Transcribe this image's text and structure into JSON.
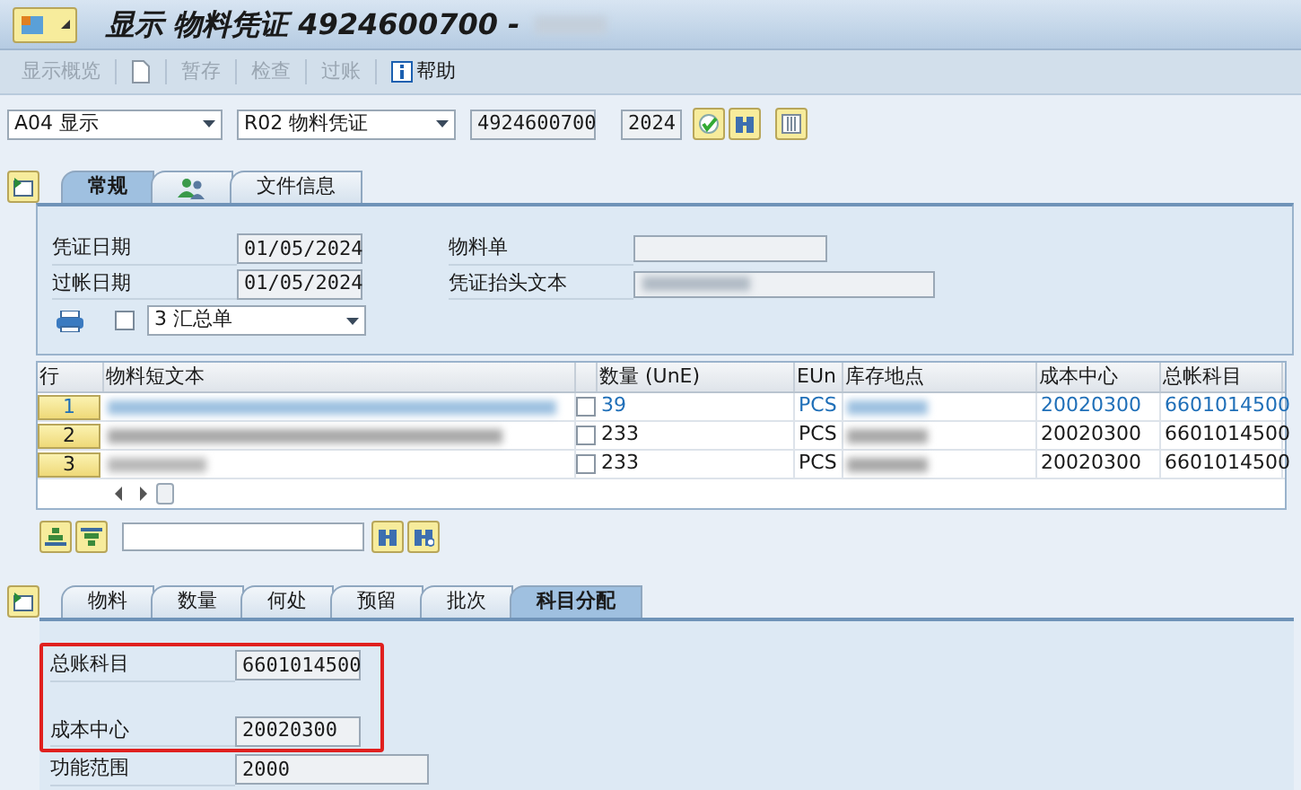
{
  "window": {
    "title": "显示 物料凭证 4924600700 -"
  },
  "toolbar": [
    {
      "kind": "button",
      "label": "显示概览",
      "disabled": true
    },
    {
      "kind": "page-icon"
    },
    {
      "kind": "button",
      "label": "暂存",
      "disabled": true
    },
    {
      "kind": "button",
      "label": "检查",
      "disabled": true
    },
    {
      "kind": "button",
      "label": "过账",
      "disabled": true
    },
    {
      "kind": "help",
      "label": "帮助",
      "disabled": false
    }
  ],
  "selectors": {
    "action": "A04 显示",
    "reference": "R02 物料凭证",
    "document_number": "4924600700",
    "year": "2024"
  },
  "header_tabs": [
    {
      "kind": "text",
      "label": "常规",
      "selected": true
    },
    {
      "kind": "people-icon",
      "selected": false
    },
    {
      "kind": "text",
      "label": "文件信息",
      "selected": false
    }
  ],
  "general": {
    "left_fields": [
      {
        "label": "凭证日期",
        "value": "01/05/2024"
      },
      {
        "label": "过帐日期",
        "value": "01/05/2024"
      }
    ],
    "right_fields": [
      {
        "label": "物料单",
        "redacted": false
      },
      {
        "label": "凭证抬头文本",
        "redacted": true
      }
    ],
    "print_checkbox": {
      "checked": false
    },
    "print_version": "3 汇总单"
  },
  "table": {
    "columns": [
      "行",
      "物料短文本",
      "数量 (UnE)",
      "EUn",
      "库存地点",
      "成本中心",
      "总帐科目"
    ],
    "rows": [
      {
        "line": "1",
        "selected": true,
        "checked": false,
        "quantity": "39",
        "unit": "PCS",
        "cost_center": "20020300",
        "gl_account": "6601014500"
      },
      {
        "line": "2",
        "selected": false,
        "checked": false,
        "quantity": "233",
        "unit": "PCS",
        "cost_center": "20020300",
        "gl_account": "6601014500"
      },
      {
        "line": "3",
        "selected": false,
        "checked": false,
        "quantity": "233",
        "unit": "PCS",
        "cost_center": "20020300",
        "gl_account": "6601014500"
      }
    ]
  },
  "item_tabs": [
    {
      "label": "物料",
      "selected": false
    },
    {
      "label": "数量",
      "selected": false
    },
    {
      "label": "何处",
      "selected": false
    },
    {
      "label": "预留",
      "selected": false
    },
    {
      "label": "批次",
      "selected": false
    },
    {
      "label": "科目分配",
      "selected": true
    }
  ],
  "account_fields": [
    {
      "label": "总账科目",
      "value": "6601014500",
      "highlighted": true
    },
    {
      "label": "成本中心",
      "value": "20020300",
      "highlighted": true
    },
    {
      "label": "功能范围",
      "value": "2000",
      "highlighted": false
    }
  ]
}
